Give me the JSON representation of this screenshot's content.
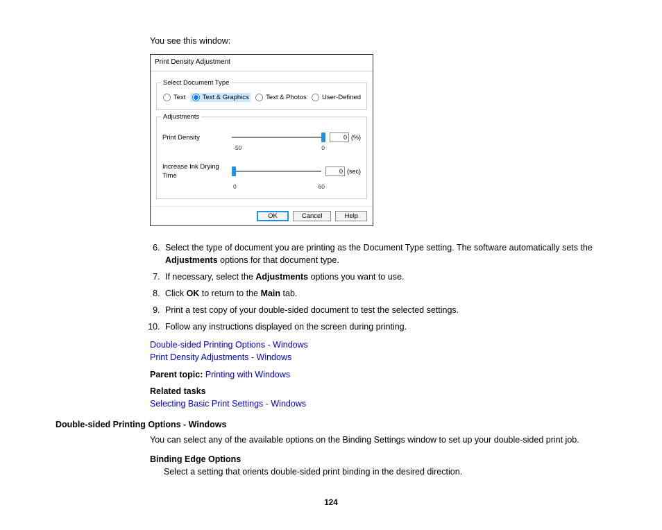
{
  "intro": "You see this window:",
  "dialog": {
    "title": "Print Density Adjustment",
    "group_doc_type": "Select Document Type",
    "doc_types": {
      "text": "Text",
      "text_graphics": "Text & Graphics",
      "text_photos": "Text & Photos",
      "user_defined": "User-Defined"
    },
    "group_adjustments": "Adjustments",
    "print_density_label": "Print Density",
    "print_density_value": "0",
    "print_density_unit": "(%)",
    "print_density_min": "-50",
    "print_density_max": "0",
    "dry_time_label": "Increase Ink Drying Time",
    "dry_time_value": "0",
    "dry_time_unit": "(sec)",
    "dry_time_min": "0",
    "dry_time_max": "60",
    "btn_ok": "OK",
    "btn_cancel": "Cancel",
    "btn_help": "Help"
  },
  "steps": {
    "s6a": "Select the type of document you are printing as the Document Type setting. The software automatically sets the ",
    "s6b": "Adjustments",
    "s6c": " options for that document type.",
    "s7a": "If necessary, select the ",
    "s7b": "Adjustments",
    "s7c": " options you want to use.",
    "s8a": "Click ",
    "s8b": "OK",
    "s8c": " to return to the ",
    "s8d": "Main",
    "s8e": " tab.",
    "s9": "Print a test copy of your double-sided document to test the selected settings.",
    "s10": "Follow any instructions displayed on the screen during printing."
  },
  "links": {
    "l1": "Double-sided Printing Options - Windows",
    "l2": "Print Density Adjustments - Windows",
    "parent_label": "Parent topic: ",
    "parent_link": "Printing with Windows",
    "related_tasks": "Related tasks",
    "l3": "Selecting Basic Print Settings - Windows"
  },
  "section": {
    "heading": "Double-sided Printing Options - Windows",
    "body": "You can select any of the available options on the Binding Settings window to set up your double-sided print job.",
    "sub_heading": "Binding Edge Options",
    "sub_body": "Select a setting that orients double-sided print binding in the desired direction."
  },
  "page_number": "124"
}
